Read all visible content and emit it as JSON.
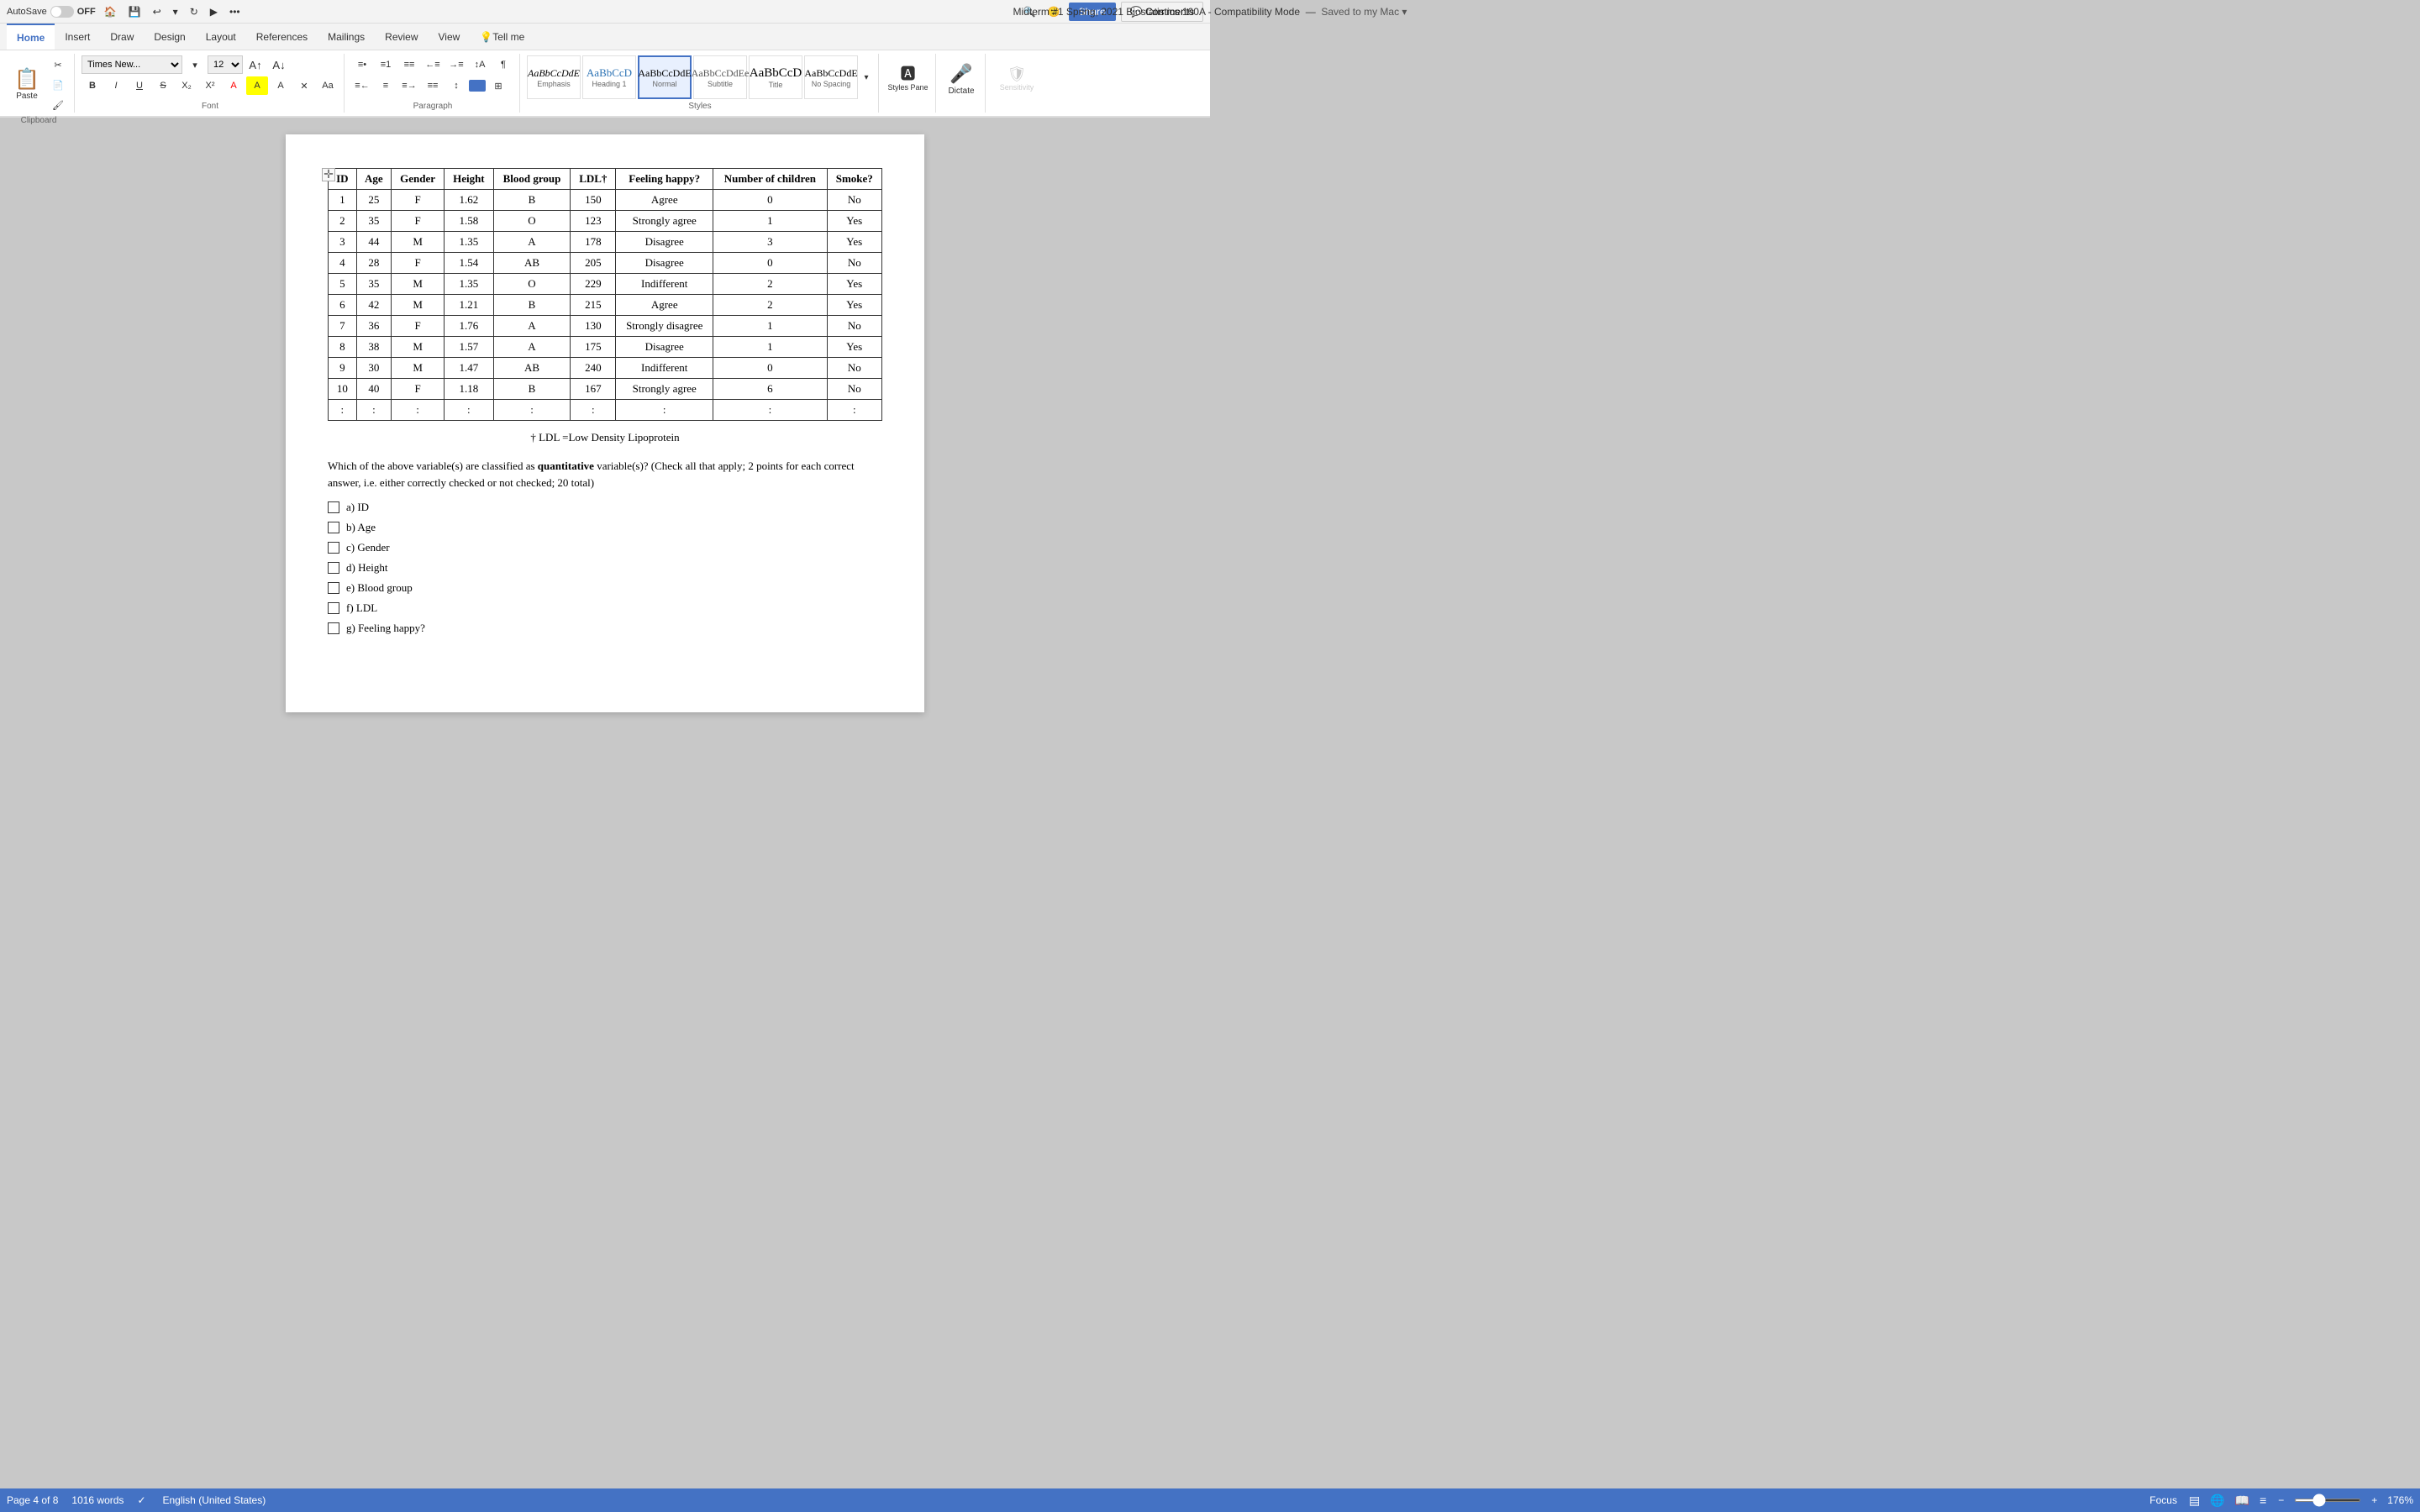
{
  "titlebar": {
    "autosave_label": "AutoSave",
    "autosave_state": "OFF",
    "title": "Midterm #1 Spring, 2021 Biostatistics 100A  -  Compatibility Mode",
    "save_status": "Saved to my Mac",
    "home_icon": "🏠",
    "save_icon": "💾",
    "undo_icon": "↩",
    "redo_icon": "↻",
    "present_icon": "▶",
    "more_icon": "•••"
  },
  "ribbon": {
    "tabs": [
      "Home",
      "Insert",
      "Draw",
      "Design",
      "Layout",
      "References",
      "Mailings",
      "Review",
      "View"
    ],
    "active_tab": "Home",
    "tell_me": "Tell me",
    "share_label": "Share",
    "comments_label": "Comments"
  },
  "toolbar": {
    "clipboard_group": "Clipboard",
    "paste_label": "Paste",
    "font_name": "Times New...",
    "font_size": "12",
    "font_group": "Font",
    "paragraph_group": "Paragraph",
    "styles_group": "Styles",
    "styles": [
      {
        "label": "Emphasis",
        "text": "AaBbCcDdE"
      },
      {
        "label": "Heading 1",
        "text": "AaBbCcD"
      },
      {
        "label": "Normal",
        "text": "AaBbCcDdE",
        "active": true
      },
      {
        "label": "Subtitle",
        "text": "AaBbCcDdEe"
      },
      {
        "label": "Title",
        "text": "AaBbCcD"
      },
      {
        "label": "No Spacing",
        "text": "AaBbCcDdE"
      }
    ],
    "dictate_label": "Dictate",
    "sensitivity_label": "Sensitivity",
    "styles_pane_label": "Styles Pane"
  },
  "table": {
    "headers": [
      "ID",
      "Age",
      "Gender",
      "Height",
      "Blood group",
      "LDL†",
      "Feeling happy?",
      "Number of children",
      "Smoke?"
    ],
    "rows": [
      [
        "1",
        "25",
        "F",
        "1.62",
        "B",
        "150",
        "Agree",
        "0",
        "No"
      ],
      [
        "2",
        "35",
        "F",
        "1.58",
        "O",
        "123",
        "Strongly agree",
        "1",
        "Yes"
      ],
      [
        "3",
        "44",
        "M",
        "1.35",
        "A",
        "178",
        "Disagree",
        "3",
        "Yes"
      ],
      [
        "4",
        "28",
        "F",
        "1.54",
        "AB",
        "205",
        "Disagree",
        "0",
        "No"
      ],
      [
        "5",
        "35",
        "M",
        "1.35",
        "O",
        "229",
        "Indifferent",
        "2",
        "Yes"
      ],
      [
        "6",
        "42",
        "M",
        "1.21",
        "B",
        "215",
        "Agree",
        "2",
        "Yes"
      ],
      [
        "7",
        "36",
        "F",
        "1.76",
        "A",
        "130",
        "Strongly disagree",
        "1",
        "No"
      ],
      [
        "8",
        "38",
        "M",
        "1.57",
        "A",
        "175",
        "Disagree",
        "1",
        "Yes"
      ],
      [
        "9",
        "30",
        "M",
        "1.47",
        "AB",
        "240",
        "Indifferent",
        "0",
        "No"
      ],
      [
        "10",
        "40",
        "F",
        "1.18",
        "B",
        "167",
        "Strongly agree",
        "6",
        "No"
      ],
      [
        ":",
        ":",
        ":",
        ":",
        ":",
        ":",
        ":",
        ":",
        ":"
      ]
    ],
    "footnote": "† LDL =Low Density Lipoprotein"
  },
  "question": {
    "text_prefix": "Which of the above variable(s) are classified as ",
    "text_bold": "quantitative",
    "text_suffix": " variable(s)? (Check all that apply; 2 points for each correct answer, i.e. either correctly checked or not checked; 20 total)",
    "options": [
      {
        "id": "a",
        "label": "a) ID"
      },
      {
        "id": "b",
        "label": "b) Age"
      },
      {
        "id": "c",
        "label": "c) Gender"
      },
      {
        "id": "d",
        "label": "d) Height"
      },
      {
        "id": "e",
        "label": "e) Blood group"
      },
      {
        "id": "f",
        "label": "f) LDL"
      },
      {
        "id": "g",
        "label": "g) Feeling happy?"
      }
    ]
  },
  "statusbar": {
    "page_info": "Page 4 of 8",
    "word_count": "1016 words",
    "language": "English (United States)",
    "focus_label": "Focus",
    "zoom_level": "176%",
    "zoom_value": 176
  },
  "styles_pane": {
    "label": "Styles Pane"
  }
}
